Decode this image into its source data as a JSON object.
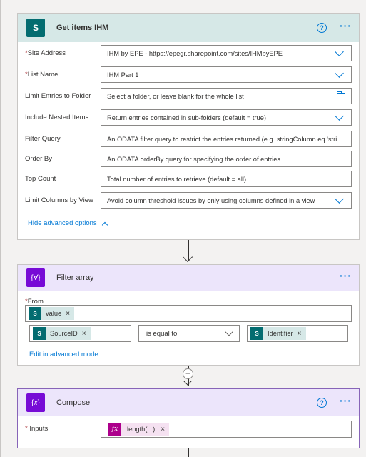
{
  "sharepoint": {
    "title": "Get items IHM",
    "icon_letter": "S",
    "fields": [
      {
        "label": "Site Address",
        "required": true,
        "value": "IHM by EPE - https://epegr.sharepoint.com/sites/IHMbyEPE",
        "control": "dropdown"
      },
      {
        "label": "List Name",
        "required": true,
        "value": "IHM Part 1",
        "control": "dropdown"
      },
      {
        "label": "Limit Entries to Folder",
        "required": false,
        "value": "Select a folder, or leave blank for the whole list",
        "control": "folder"
      },
      {
        "label": "Include Nested Items",
        "required": false,
        "value": "Return entries contained in sub-folders (default = true)",
        "control": "dropdown"
      },
      {
        "label": "Filter Query",
        "required": false,
        "value": "An ODATA filter query to restrict the entries returned (e.g. stringColumn eq 'stri",
        "control": "text"
      },
      {
        "label": "Order By",
        "required": false,
        "value": "An ODATA orderBy query for specifying the order of entries.",
        "control": "text"
      },
      {
        "label": "Top Count",
        "required": false,
        "value": "Total number of entries to retrieve (default = all).",
        "control": "text"
      },
      {
        "label": "Limit Columns by View",
        "required": false,
        "value": "Avoid column threshold issues by only using columns defined in a view",
        "control": "dropdown"
      }
    ],
    "advanced_link": "Hide advanced options"
  },
  "filter": {
    "title": "Filter array",
    "icon_text": "{∀}",
    "from_label": "From",
    "from_token": "value",
    "left_token": "SourceID",
    "operator": "is equal to",
    "right_token": "Identifier",
    "edit_link": "Edit in advanced mode"
  },
  "compose": {
    "title": "Compose",
    "icon_text": "{𝑥}",
    "inputs_label": "Inputs",
    "inputs_token": "length(...)"
  },
  "common": {
    "help_glyph": "?",
    "more_glyph": "···",
    "remove_glyph": "×",
    "plus_glyph": "+",
    "token_icon": "S",
    "fx_glyph": "fx",
    "required_mark": "*"
  },
  "colors": {
    "sharepoint": "#036c70",
    "variable": "#770bd6",
    "expression": "#ad008c",
    "link": "#0078d4",
    "required": "#a4262c"
  }
}
